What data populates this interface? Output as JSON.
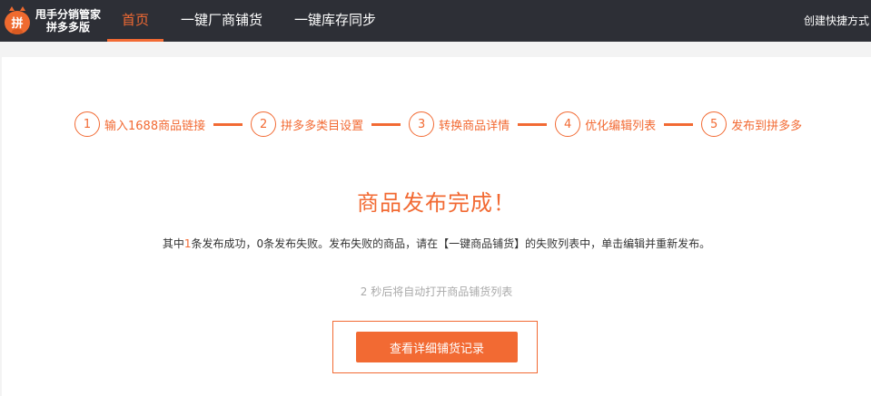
{
  "header": {
    "logo_char": "拼",
    "logo_line1": "甩手分销管家",
    "logo_line2": "拼多多版",
    "nav": [
      {
        "label": "首页",
        "active": true
      },
      {
        "label": "一键厂商铺货",
        "active": false
      },
      {
        "label": "一键库存同步",
        "active": false
      }
    ],
    "shortcut_label": "创建快捷方式"
  },
  "steps": [
    {
      "num": "1",
      "label": "输入1688商品链接"
    },
    {
      "num": "2",
      "label": "拼多多类目设置"
    },
    {
      "num": "3",
      "label": "转换商品详情"
    },
    {
      "num": "4",
      "label": "优化编辑列表"
    },
    {
      "num": "5",
      "label": "发布到拼多多"
    }
  ],
  "result": {
    "title": "商品发布完成！",
    "summary_prefix": "其中",
    "success_count": "1",
    "summary_mid": "条发布成功，",
    "fail_count": "0",
    "summary_suffix": "条发布失败。发布失败的商品，请在【一键商品铺货】的失败列表中，单击编辑并重新发布。",
    "countdown": "2 秒后将自动打开商品铺货列表",
    "button_label": "查看详细铺货记录"
  },
  "colors": {
    "accent": "#f26a33",
    "topbar": "#2d2f36"
  }
}
